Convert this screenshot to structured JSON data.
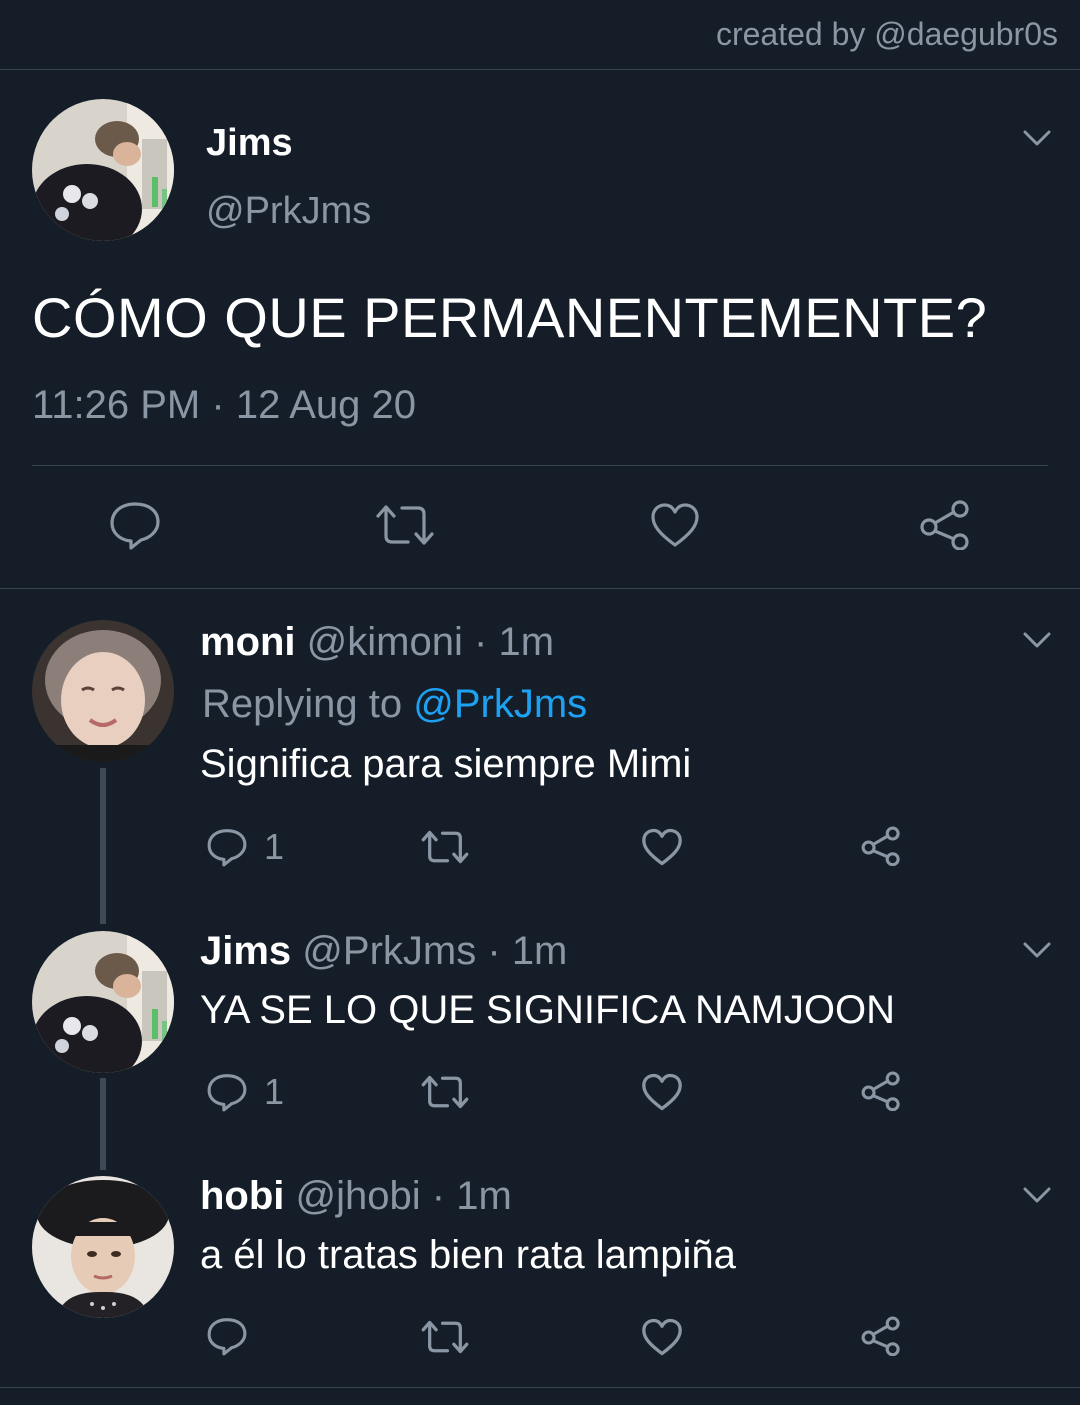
{
  "credit": "created by @daegubr0s",
  "main_tweet": {
    "name": "Jims",
    "handle": "@PrkJms",
    "text": "CÓMO QUE PERMANENTEMENTE?",
    "time": "11:26 PM",
    "separator": "·",
    "date": "12 Aug 20"
  },
  "replies": [
    {
      "name": "moni",
      "handle": "@kimoni",
      "dot": "·",
      "age": "1m",
      "replying_prefix": "Replying to",
      "replying_to": "@PrkJms",
      "text": "Significa para siempre Mimi",
      "reply_count": "1"
    },
    {
      "name": "Jims",
      "handle": "@PrkJms",
      "dot": "·",
      "age": "1m",
      "text": "YA SE LO QUE SIGNIFICA NAMJOON",
      "reply_count": "1"
    },
    {
      "name": "hobi",
      "handle": "@jhobi",
      "dot": "·",
      "age": "1m",
      "text": "a él lo tratas bien rata lampiña",
      "reply_count": ""
    }
  ],
  "icons": {
    "reply": "speech-bubble-icon",
    "retweet": "retweet-icon",
    "like": "heart-icon",
    "share": "share-icon",
    "more": "chevron-down-icon"
  },
  "colors": {
    "background": "#151d28",
    "muted": "#8a96a3",
    "link": "#1da1f2",
    "divider": "#38444d"
  }
}
